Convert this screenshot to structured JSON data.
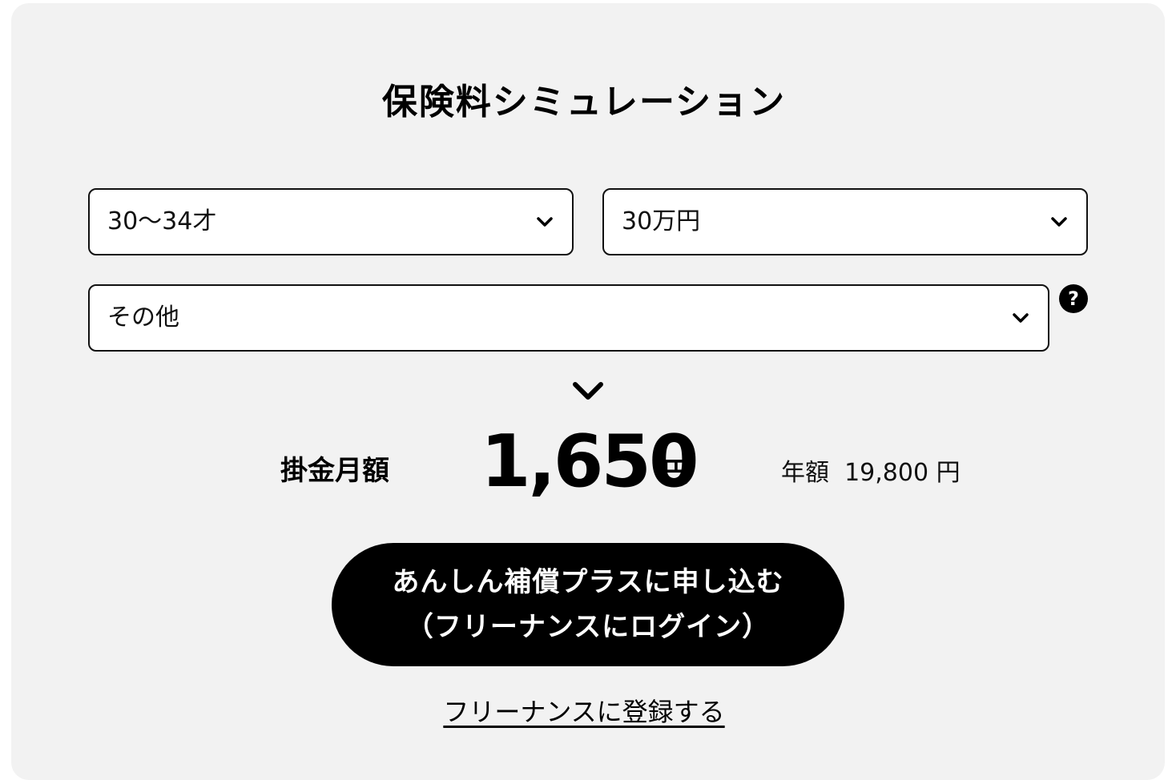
{
  "title": "保険料シミュレーション",
  "selects": {
    "age": "30〜34才",
    "amount": "30万円",
    "occupation": "その他"
  },
  "help_icon_text": "?",
  "result": {
    "monthly_label": "掛金月額",
    "monthly_value": "1,650",
    "monthly_unit": "円",
    "annual_text": "年額  19,800 円"
  },
  "apply_button": {
    "line1": "あんしん補償プラスに申し込む",
    "line2": "（フリーナンスにログイン）"
  },
  "register_link": "フリーナンスに登録する",
  "icons": {
    "select_chevron": "chevron-down-icon",
    "help": "question-circle-icon",
    "result_arrow": "chevron-down-icon"
  },
  "colors": {
    "panel_bg": "#f2f2f2",
    "button_bg": "#000000",
    "button_text": "#ffffff",
    "text": "#000000"
  }
}
